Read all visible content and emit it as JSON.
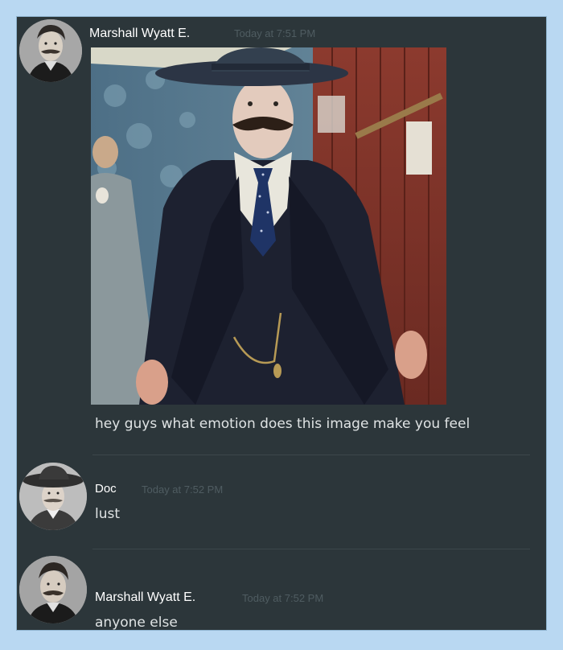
{
  "messages": [
    {
      "author": "Marshall Wyatt E.",
      "timestamp": "Today at 7:51 PM",
      "text": "hey guys what emotion does this image make you feel",
      "attachment": {
        "type": "photo",
        "subject": "man-in-dark-suit-photo"
      }
    },
    {
      "author": "Doc",
      "timestamp": "Today at 7:52 PM",
      "text": "lust"
    },
    {
      "author": "Marshall Wyatt E.",
      "timestamp": "Today at 7:52 PM",
      "text": "anyone else"
    }
  ],
  "colors": {
    "page_background": "#b9d8f2",
    "chat_background": "#2c363a",
    "username": "#ffffff",
    "message_text": "#dfe3e4",
    "timestamp": "#4f5c61"
  }
}
